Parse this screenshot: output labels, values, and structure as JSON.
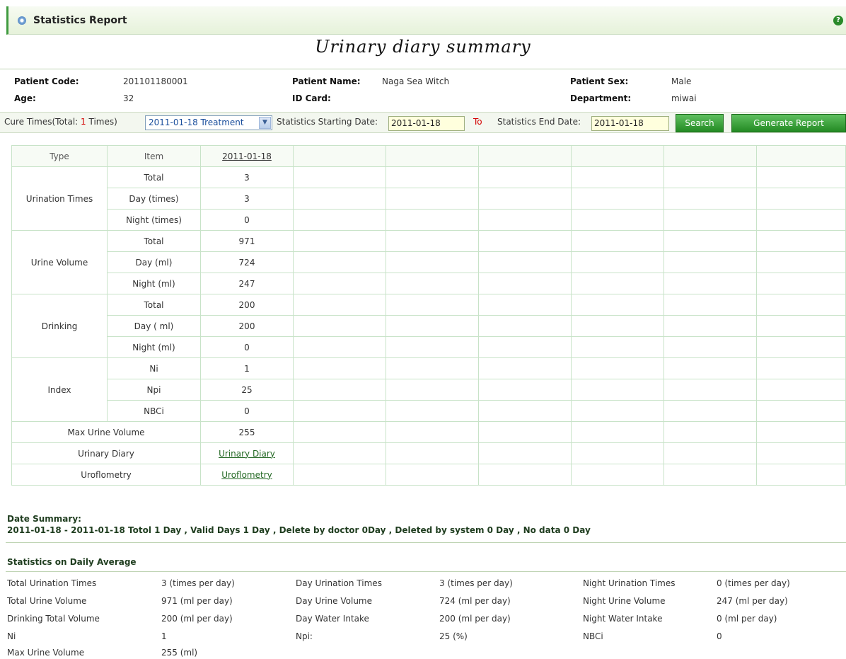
{
  "header": {
    "title": "Statistics Report",
    "help": "?"
  },
  "report_title": "Urinary diary summary",
  "patient": {
    "code_label": "Patient Code:",
    "code": "201101180001",
    "name_label": "Patient Name:",
    "name": "Naga Sea Witch",
    "sex_label": "Patient Sex:",
    "sex": "Male",
    "age_label": "Age:",
    "age": "32",
    "idcard_label": "ID Card:",
    "idcard": "",
    "dept_label": "Department:",
    "dept": "miwai"
  },
  "filter": {
    "cure_prefix": "Cure Times(Total: ",
    "cure_count": "1",
    "cure_suffix": " Times)",
    "treatment_selected": "2011-01-18 Treatment",
    "start_label": "Statistics Starting Date:",
    "start_value": "2011-01-18",
    "to_label": "To",
    "end_label": "Statistics End Date:",
    "end_value": "2011-01-18",
    "search_label": "Search",
    "generate_label": "Generate Report"
  },
  "table": {
    "headers": {
      "type": "Type",
      "item": "Item",
      "date": "2011-01-18"
    },
    "urination": {
      "type": "Urination Times",
      "total": "Total",
      "total_v": "3",
      "day": "Day (times)",
      "day_v": "3",
      "night": "Night (times)",
      "night_v": "0"
    },
    "volume": {
      "type": "Urine Volume",
      "total": "Total",
      "total_v": "971",
      "day": "Day (ml)",
      "day_v": "724",
      "night": "Night (ml)",
      "night_v": "247"
    },
    "drinking": {
      "type": "Drinking",
      "total": "Total",
      "total_v": "200",
      "day": "Day ( ml)",
      "day_v": "200",
      "night": "Night (ml)",
      "night_v": "0"
    },
    "index": {
      "type": "Index",
      "ni": "Ni",
      "ni_v": "1",
      "npi": "Npi",
      "npi_v": "25",
      "nbci": "NBCi",
      "nbci_v": "0"
    },
    "max_volume": {
      "label": "Max Urine Volume",
      "value": "255"
    },
    "diary": {
      "label": "Urinary Diary",
      "link": "Urinary Diary"
    },
    "uroflow": {
      "label": "Uroflometry",
      "link": "Uroflometry"
    }
  },
  "date_summary": {
    "title": "Date Summary:",
    "line": "2011-01-18 - 2011-01-18 Totol 1 Day ,   Valid Days 1 Day ,   Delete by doctor 0Day ,   Deleted by system 0 Day ,   No data 0 Day"
  },
  "daily_average": {
    "title": "Statistics on Daily Average",
    "rows": [
      [
        "Total Urination Times",
        "3 (times per day)",
        "Day Urination Times",
        "3 (times per day)",
        "Night Urination Times",
        "0 (times per day)"
      ],
      [
        "Total Urine Volume",
        "971 (ml per day)",
        "Day Urine Volume",
        "724 (ml per day)",
        "Night Urine Volume",
        "247 (ml per day)"
      ],
      [
        "Drinking Total Volume",
        "200 (ml per day)",
        "Day Water Intake",
        "200 (ml per day)",
        "Night Water Intake",
        "0 (ml per day)"
      ],
      [
        "Ni",
        "1",
        "Npi:",
        "25 (%)",
        "NBCi",
        "0"
      ],
      [
        "Max Urine Volume",
        "255 (ml)"
      ]
    ]
  }
}
